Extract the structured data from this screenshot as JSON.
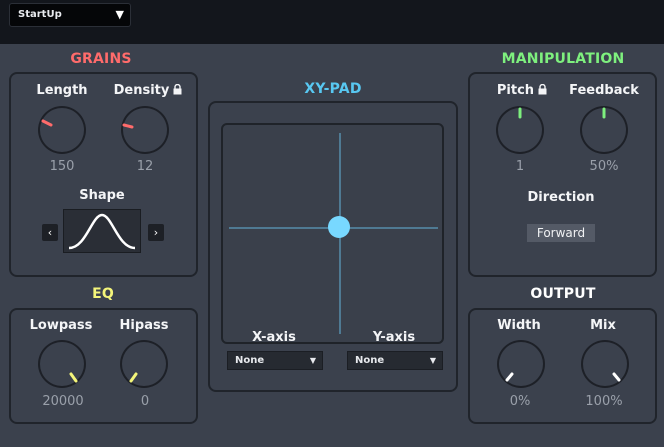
{
  "preset": {
    "value": "StartUp"
  },
  "colors": {
    "grains": "#ff6b6b",
    "eq": "#f4f57a",
    "xypad": "#58c8f2",
    "manipulation": "#7ef07e",
    "output": "#ffffff"
  },
  "grains": {
    "title": "GRAINS",
    "length": {
      "label": "Length",
      "value": "150"
    },
    "density": {
      "label": "Density",
      "value": "12"
    },
    "shape": {
      "label": "Shape"
    }
  },
  "eq": {
    "title": "EQ",
    "lowpass": {
      "label": "Lowpass",
      "value": "20000"
    },
    "hipass": {
      "label": "Hipass",
      "value": "0"
    }
  },
  "xypad": {
    "title": "XY-PAD",
    "x_axis": {
      "label": "X-axis",
      "selected": "None"
    },
    "y_axis": {
      "label": "Y-axis",
      "selected": "None"
    },
    "puck": {
      "x": 0.5,
      "y": 0.5
    }
  },
  "manipulation": {
    "title": "MANIPULATION",
    "pitch": {
      "label": "Pitch",
      "value": "1"
    },
    "feedback": {
      "label": "Feedback",
      "value": "50%"
    },
    "direction": {
      "label": "Direction",
      "value": "Forward"
    }
  },
  "output": {
    "title": "OUTPUT",
    "width": {
      "label": "Width",
      "value": "0%"
    },
    "mix": {
      "label": "Mix",
      "value": "100%"
    }
  }
}
